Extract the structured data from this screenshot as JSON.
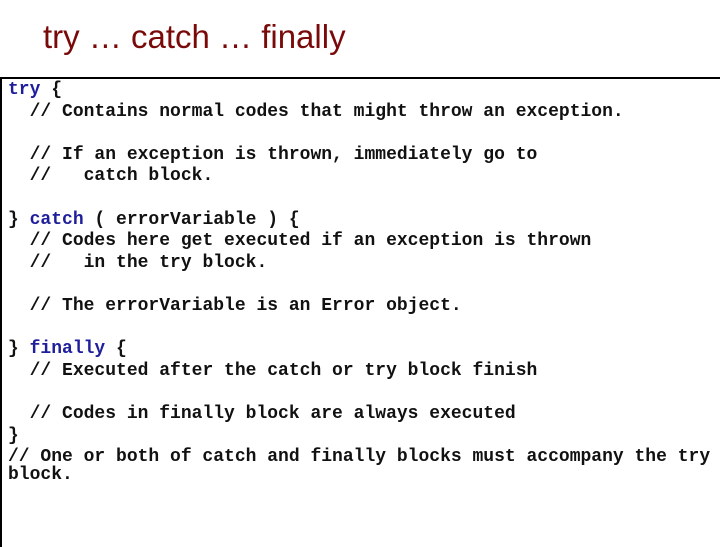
{
  "slide": {
    "title": "try … catch … finally"
  },
  "colors": {
    "title": "#7a0a0a",
    "keyword": "#1f1f9c",
    "text": "#111111",
    "border": "#000000"
  },
  "code": {
    "lines": [
      {
        "kw": "try",
        "rest": " {"
      },
      {
        "pre": "  ",
        "rest": "// Contains normal codes that might throw an exception."
      },
      {
        "rest": ""
      },
      {
        "pre": "  ",
        "rest": "// If an exception is thrown, immediately go to"
      },
      {
        "pre": "  ",
        "rest": "//   catch block."
      },
      {
        "rest": ""
      },
      {
        "pre": "} ",
        "kw": "catch",
        "rest": " ( errorVariable ) {"
      },
      {
        "pre": "  ",
        "rest": "// Codes here get executed if an exception is thrown"
      },
      {
        "pre": "  ",
        "rest": "//   in the try block."
      },
      {
        "rest": ""
      },
      {
        "pre": "  ",
        "rest": "// The errorVariable is an Error object."
      },
      {
        "rest": ""
      },
      {
        "pre": "} ",
        "kw": "finally",
        "rest": " {"
      },
      {
        "pre": "  ",
        "rest": "// Executed after the catch or try block finish"
      },
      {
        "rest": ""
      },
      {
        "pre": "  ",
        "rest": "// Codes in finally block are always executed"
      },
      {
        "rest": "}"
      },
      {
        "rest": "// One or both of catch and finally blocks must accompany the try"
      },
      {
        "rest": "block.",
        "wrap": true
      }
    ]
  }
}
